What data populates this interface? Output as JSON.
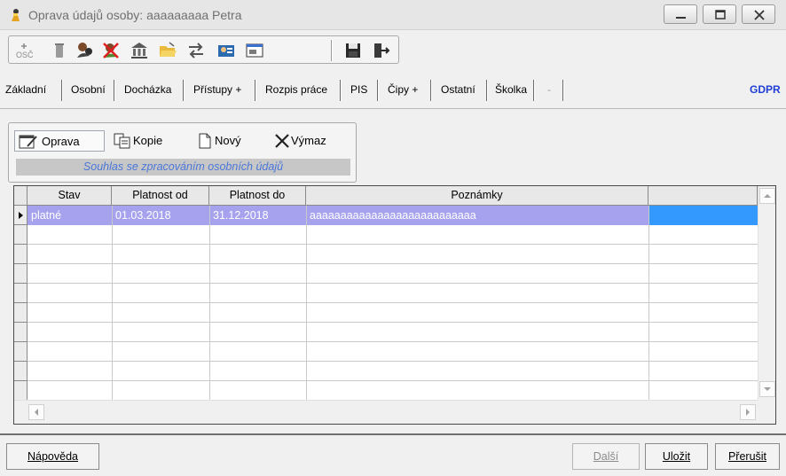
{
  "window": {
    "title": "Oprava údajů osoby: aaaaaaaaa Petra"
  },
  "toolbar": {
    "icons": [
      "osc-icon",
      "trash-icon",
      "person-icon",
      "person-delete-icon",
      "bank-icon",
      "folder-open-icon",
      "transfer-icon",
      "card-icon",
      "window-icon",
      "save-icon",
      "exit-icon"
    ]
  },
  "tabs": [
    {
      "label": "Základní"
    },
    {
      "label": "Osobní"
    },
    {
      "label": "Docházka"
    },
    {
      "label": "Přístupy +"
    },
    {
      "label": "Rozpis práce"
    },
    {
      "label": "PIS"
    },
    {
      "label": "Čipy +"
    },
    {
      "label": "Ostatní"
    },
    {
      "label": "Školka"
    },
    {
      "label": "-"
    },
    {
      "label": "GDPR"
    }
  ],
  "actions": {
    "edit": "Oprava",
    "copy": "Kopie",
    "new": "Nový",
    "delete": "Výmaz"
  },
  "section_caption": "Souhlas se zpracováním osobních údajů",
  "grid": {
    "columns": [
      "Stav",
      "Platnost od",
      "Platnost do",
      "Poznámky"
    ],
    "rows": [
      {
        "stav": "platné",
        "od": "01.03.2018",
        "do": "31.12.2018",
        "poznamky": "aaaaaaaaaaaaaaaaaaaaaaaaaaa"
      }
    ]
  },
  "footer": {
    "help": "Nápověda",
    "next": "Další",
    "save": "Uložit",
    "cancel": "Přerušit"
  },
  "colors": {
    "selection": "#a6a2ee",
    "caption_text": "#4a76d9",
    "gdpr_tab": "#1f3ed6"
  }
}
